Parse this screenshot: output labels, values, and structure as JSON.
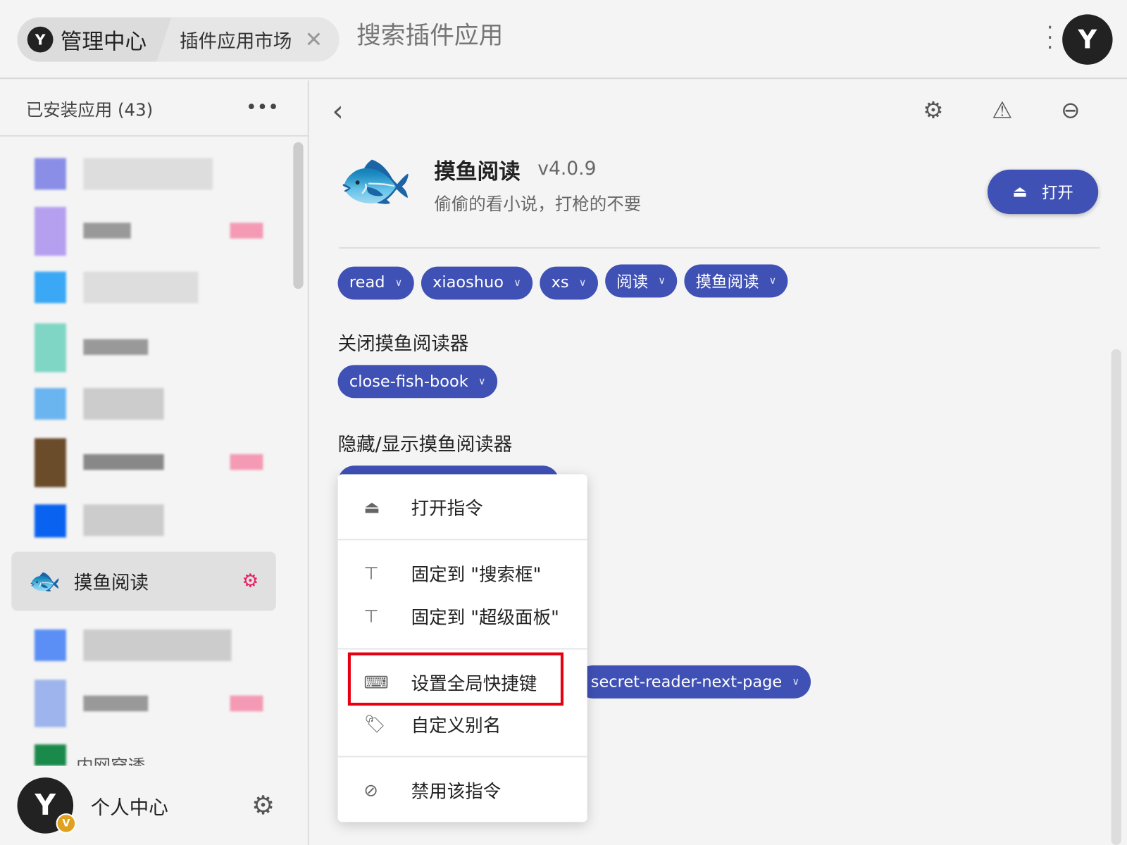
{
  "topbar": {
    "breadcrumb": [
      "管理中心",
      "插件应用市场"
    ],
    "search_placeholder": "搜索插件应用"
  },
  "sidebar": {
    "title": "已安装应用 (43)",
    "selected_item": "摸鱼阅读",
    "partial_item": "内网穿透",
    "footer_label": "个人中心",
    "badge": "V"
  },
  "detail": {
    "name": "摸鱼阅读",
    "version": "v4.0.9",
    "description": "偷偷的看小说，打枪的不要",
    "open_button": "打开",
    "sections": [
      {
        "title": "",
        "keywords": [
          "read",
          "xiaoshuo",
          "xs",
          "阅读",
          "摸鱼阅读"
        ]
      },
      {
        "title": "关闭摸鱼阅读器",
        "keywords": [
          "close-fish-book"
        ]
      },
      {
        "title": "隐藏/显示摸鱼阅读器",
        "keywords": [
          ""
        ]
      }
    ],
    "extra_keyword": "secret-reader-next-page"
  },
  "context_menu": {
    "items": [
      "打开指令",
      "固定到 \"搜索框\"",
      "固定到 \"超级面板\"",
      "设置全局快捷键",
      "自定义别名",
      "禁用该指令"
    ],
    "highlighted": "设置全局快捷键"
  },
  "colors": {
    "accent": "#3f51b5",
    "highlight_border": "#e60012",
    "plugin_badge": "#e91e63"
  }
}
